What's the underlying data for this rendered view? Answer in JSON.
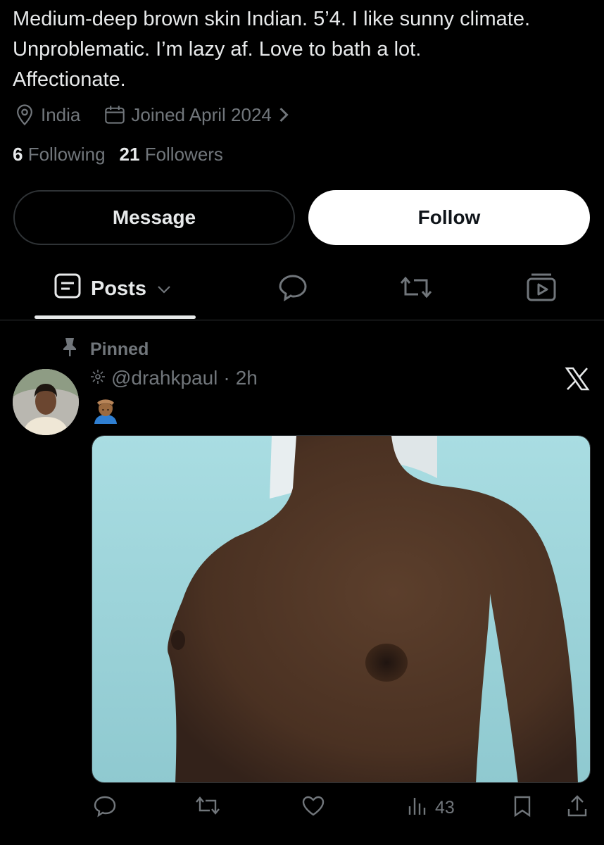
{
  "profile": {
    "bio_lines": [
      "Medium-deep brown skin Indian. 5’4. I like sunny climate.",
      "Unproblematic. I’m lazy af. Love to bath a lot.",
      "Affectionate."
    ],
    "location": "India",
    "joined": "Joined April 2024",
    "following_count": "6",
    "following_label": "Following",
    "followers_count": "21",
    "followers_label": "Followers"
  },
  "buttons": {
    "message": "Message",
    "follow": "Follow"
  },
  "tabs": {
    "posts": "Posts"
  },
  "post": {
    "pinned_label": "Pinned",
    "handle": "@drahkpaul",
    "separator": "·",
    "time": "2h",
    "views": "43"
  },
  "colors": {
    "background": "#000000",
    "text_primary": "#e7e9ea",
    "text_secondary": "#71767b",
    "border": "#2f3336",
    "follow_bg": "#ffffff"
  },
  "icons": [
    "location-icon",
    "calendar-icon",
    "chevron-right-icon",
    "posts-icon",
    "chevron-down-icon",
    "reply-icon",
    "repost-icon",
    "media-icon",
    "pin-icon",
    "sparkle-icon",
    "x-logo-icon",
    "like-icon",
    "views-icon",
    "bookmark-icon",
    "share-icon"
  ]
}
